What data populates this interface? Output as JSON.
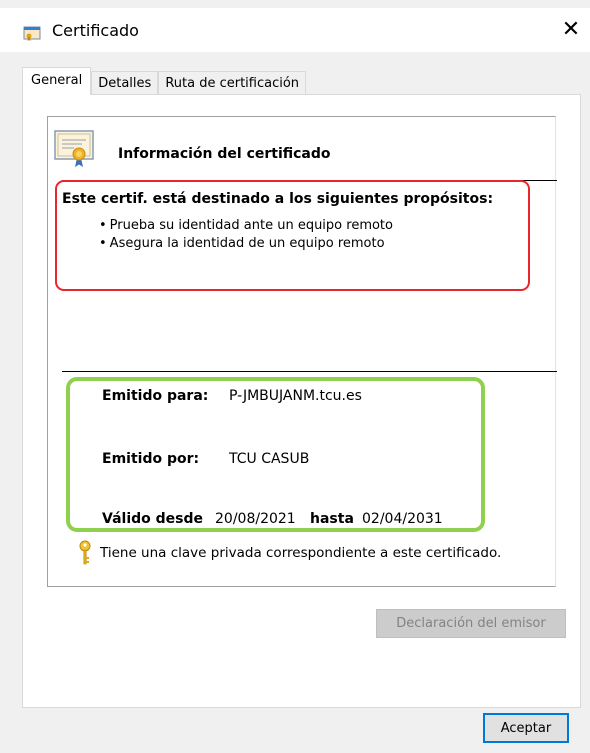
{
  "window": {
    "title": "Certificado",
    "close_glyph": "✕"
  },
  "tabs": [
    {
      "label": "General",
      "active": true
    },
    {
      "label": "Detalles",
      "active": false
    },
    {
      "label": "Ruta de certificación",
      "active": false
    }
  ],
  "info": {
    "title": "Información del certificado",
    "icon": "certificate-icon"
  },
  "purposes": {
    "title": "Este certif. está destinado a los siguientes propósitos:",
    "items": [
      "Prueba su identidad ante un equipo remoto",
      "Asegura la identidad de un equipo remoto"
    ]
  },
  "fields": {
    "issued_to_label": "Emitido para:",
    "issued_to_value": "P-JMBUJANM.tcu.es",
    "issued_by_label": "Emitido por:",
    "issued_by_value": "TCU CASUB",
    "valid_from_label": "Válido desde",
    "valid_from_value": "20/08/2021",
    "valid_to_label": "hasta",
    "valid_to_value": "02/04/2031"
  },
  "private_key": {
    "text": "Tiene una clave privada correspondiente a este certificado.",
    "icon": "key-icon"
  },
  "buttons": {
    "issuer_statement": "Declaración del emisor",
    "ok": "Aceptar"
  },
  "colors": {
    "highlight_red": "#e8262b",
    "highlight_green": "#8fd14f",
    "focus_blue": "#0078d7"
  }
}
